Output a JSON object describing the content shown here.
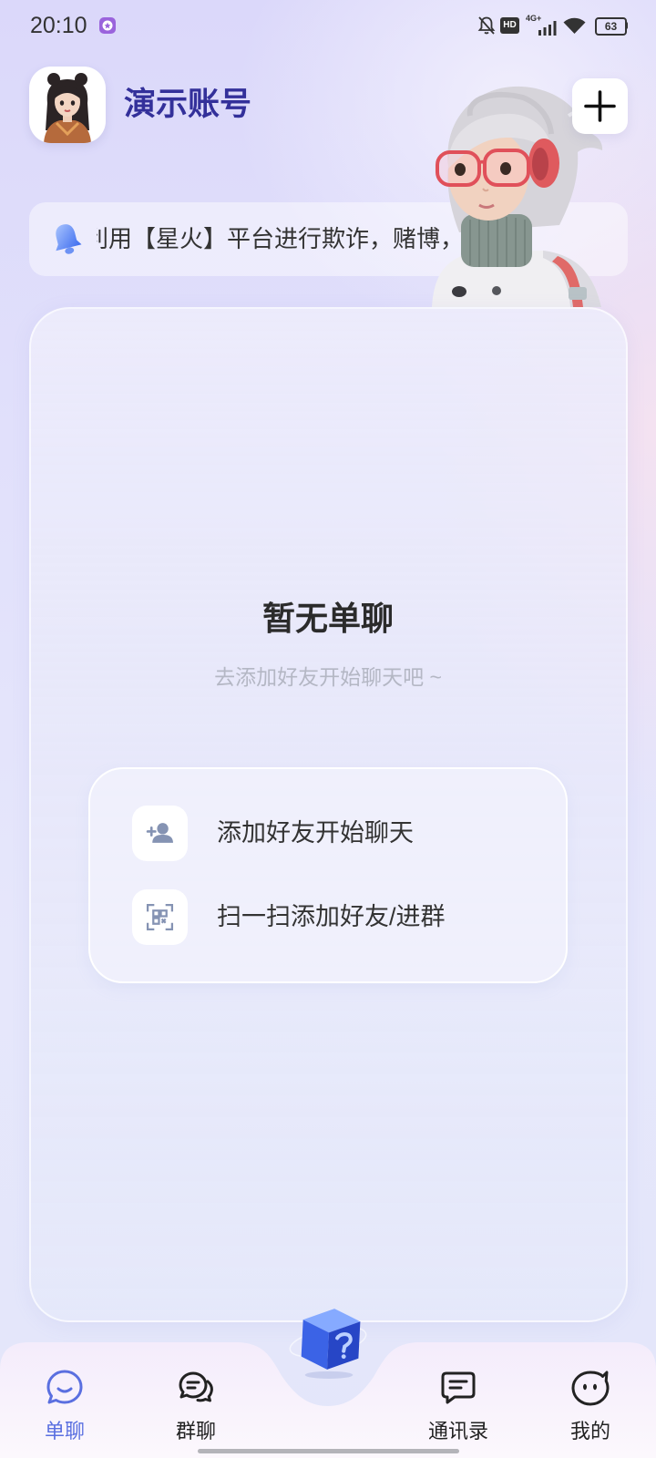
{
  "status_bar": {
    "time": "20:10",
    "app_icon": "app-notification-icon",
    "mute_icon": "mute-bell-icon",
    "hd_badge": "HD",
    "network": "4G+",
    "wifi_icon": "wifi-icon",
    "battery": "63"
  },
  "header": {
    "account_name": "演示账号",
    "add_button_icon": "plus-icon"
  },
  "notice": {
    "icon": "bell-icon",
    "text": "利用【星火】平台进行欺诈，赌博，色"
  },
  "empty_state": {
    "title": "暂无单聊",
    "subtitle": "去添加好友开始聊天吧 ~"
  },
  "actions": [
    {
      "icon": "add-friend-icon",
      "label": "添加好友开始聊天"
    },
    {
      "icon": "scan-qr-icon",
      "label": "扫一扫添加好友/进群"
    }
  ],
  "tab_bar": {
    "center_icon": "mystery-box-icon",
    "tabs": [
      {
        "label": "单聊",
        "icon": "single-chat-icon",
        "active": true
      },
      {
        "label": "群聊",
        "icon": "group-chat-icon",
        "active": false
      },
      {
        "label": "通讯录",
        "icon": "contacts-icon",
        "active": false
      },
      {
        "label": "我的",
        "icon": "profile-icon",
        "active": false
      }
    ]
  },
  "colors": {
    "accent": "#5a6fe0",
    "title": "#33309a",
    "primary_text": "#2b2b2b",
    "secondary_text": "#b4b7c4",
    "icon_muted": "#8593b3"
  }
}
